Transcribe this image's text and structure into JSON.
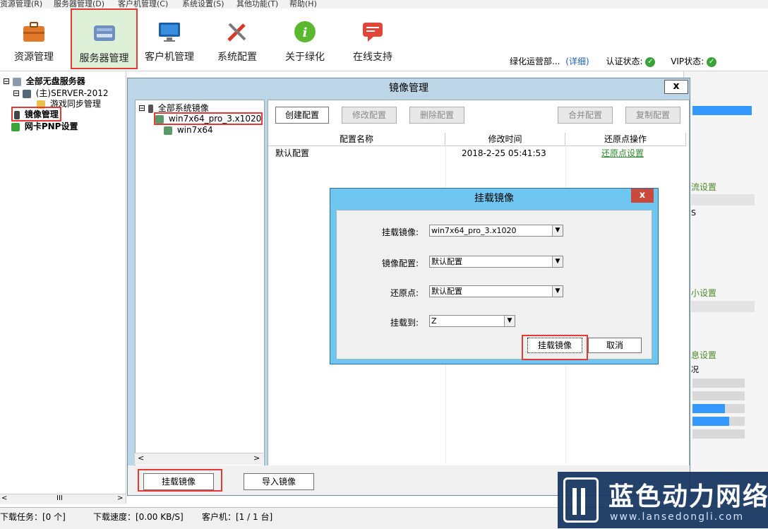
{
  "menubar": [
    "资源管理(R)",
    "服务器管理(D)",
    "客户机管理(C)",
    "系统设置(S)",
    "其他功能(T)",
    "帮助(H)"
  ],
  "toolbar": {
    "items": [
      "资源管理",
      "服务器管理",
      "客户机管理",
      "系统配置",
      "关于绿化",
      "在线支持"
    ],
    "operator": "绿化运营部...",
    "detail_link": "(详细)",
    "auth_label": "认证状态:",
    "vip_label": "VIP状态:",
    "ok_color": "#3aa43a"
  },
  "left_tree": {
    "root": "全部无盘服务器",
    "server": "(主)SERVER-2012",
    "game_sync": "游戏同步管理",
    "mirror_mgmt": "镜像管理",
    "pnp": "网卡PNP设置"
  },
  "right_panel": {
    "label1": "流设置",
    "s_letter": "S",
    "label2": "小设置",
    "label3": "息设置",
    "char": "况"
  },
  "statusbar": {
    "tasks": "下载任务：[0 个]",
    "speed": "下载速度：[0.00 KB/S]",
    "clients": "客户机：[1 / 1 台]"
  },
  "mirror_dialog": {
    "title": "镜像管理",
    "close": "x",
    "tree_root": "全部系统镜像",
    "tree_items": [
      "win7x64_pro_3.x1020",
      "win7x64"
    ],
    "buttons": [
      "创建配置",
      "修改配置",
      "删除配置",
      "合并配置",
      "复制配置"
    ],
    "columns": [
      "配置名称",
      "修改时间",
      "还原点操作"
    ],
    "rows": [
      {
        "name": "默认配置",
        "time": "2018-2-25 05:41:53",
        "action": "还原点设置"
      }
    ],
    "bottom_buttons": [
      "挂载镜像",
      "导入镜像"
    ],
    "scroll_mid": "III"
  },
  "mount_dialog": {
    "title": "挂载镜像",
    "close": "x",
    "fields": [
      {
        "label": "挂载镜像:",
        "value": "win7x64_pro_3.x1020"
      },
      {
        "label": "镜像配置:",
        "value": "默认配置"
      },
      {
        "label": "还原点:",
        "value": "默认配置"
      },
      {
        "label": "挂载到:",
        "value": "Z"
      }
    ],
    "ok": "挂载镜像",
    "cancel": "取消"
  },
  "watermark": {
    "text": "蓝色动力网络",
    "url": "www.lansedongli.com"
  }
}
